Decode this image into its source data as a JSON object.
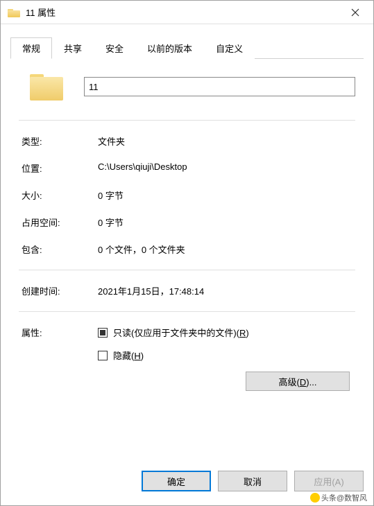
{
  "window": {
    "title": "11 属性"
  },
  "tabs": {
    "general": "常规",
    "sharing": "共享",
    "security": "安全",
    "previous_versions": "以前的版本",
    "custom": "自定义"
  },
  "name_value": "11",
  "props": {
    "type": {
      "label": "类型:",
      "value": "文件夹"
    },
    "location": {
      "label": "位置:",
      "value": "C:\\Users\\qiuji\\Desktop"
    },
    "size": {
      "label": "大小:",
      "value": "0 字节"
    },
    "size_on_disk": {
      "label": "占用空间:",
      "value": "0 字节"
    },
    "contains": {
      "label": "包含:",
      "value": "0 个文件，0 个文件夹"
    },
    "created": {
      "label": "创建时间:",
      "value": "2021年1月15日，17:48:14"
    }
  },
  "attributes": {
    "label": "属性:",
    "readonly_prefix": "只读(仅应用于文件夹中的文件)(",
    "readonly_key": "R",
    "readonly_suffix": ")",
    "hidden_prefix": "隐藏(",
    "hidden_key": "H",
    "hidden_suffix": ")",
    "advanced_prefix": "高级(",
    "advanced_key": "D",
    "advanced_suffix": ")..."
  },
  "buttons": {
    "ok": "确定",
    "cancel": "取消",
    "apply_prefix": "应用(",
    "apply_key": "A",
    "apply_suffix": ")"
  },
  "watermark": {
    "text": "头条@数智风"
  }
}
